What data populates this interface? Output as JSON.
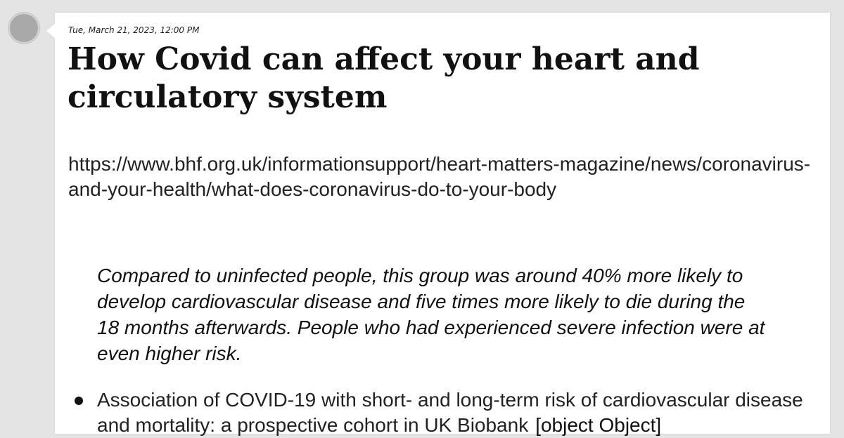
{
  "post": {
    "timestamp": "Tue, March 21, 2023, 12:00 PM",
    "title": "How Covid can affect your heart and circulatory system",
    "url": "https://www.bhf.org.uk/informationsupport/heart-matters-magazine/news/coronavirus-and-your-health/what-does-coronavirus-do-to-your-body",
    "quote": "Compared to uninfected people, this group was around 40% more likely to develop cardiovascular disease and five times more likely to die during the 18 months afterwards. People who had experienced severe infection were at even higher risk.",
    "references": [
      {
        "text": "Association of COVID-19 with short- and long-term risk of cardiovascular disease and mortality: a prospective cohort in UK Biobank",
        "extra": "[object Object]"
      }
    ]
  }
}
